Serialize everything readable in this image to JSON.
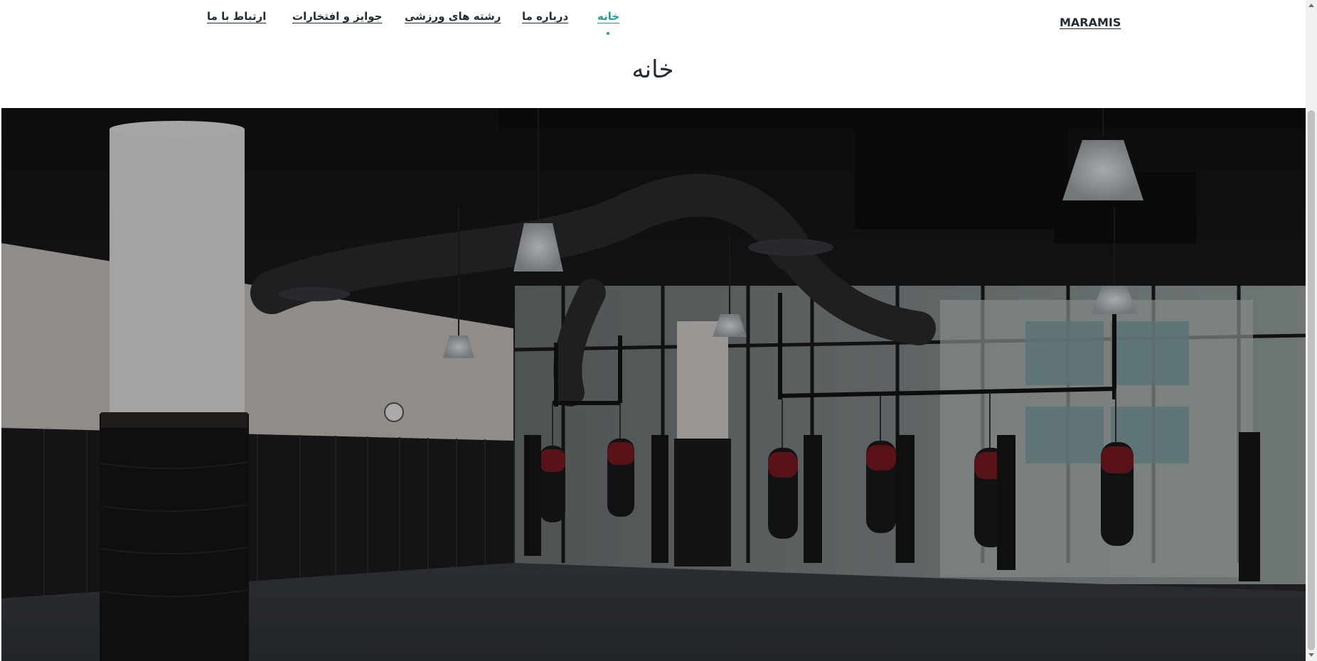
{
  "header": {
    "brand": "MARAMIS",
    "nav": {
      "home": "خانه",
      "about": "درباره ما",
      "sports": "رشته های ورزشی",
      "awards": "جوایز و افتخارات",
      "contact": "ارتباط با ما"
    },
    "active_tab": "home"
  },
  "main": {
    "title": "خانه"
  },
  "hero": {
    "icon": "gym-interior-photo"
  },
  "colors": {
    "accent": "#1aa39a",
    "text": "#1f2d36"
  }
}
